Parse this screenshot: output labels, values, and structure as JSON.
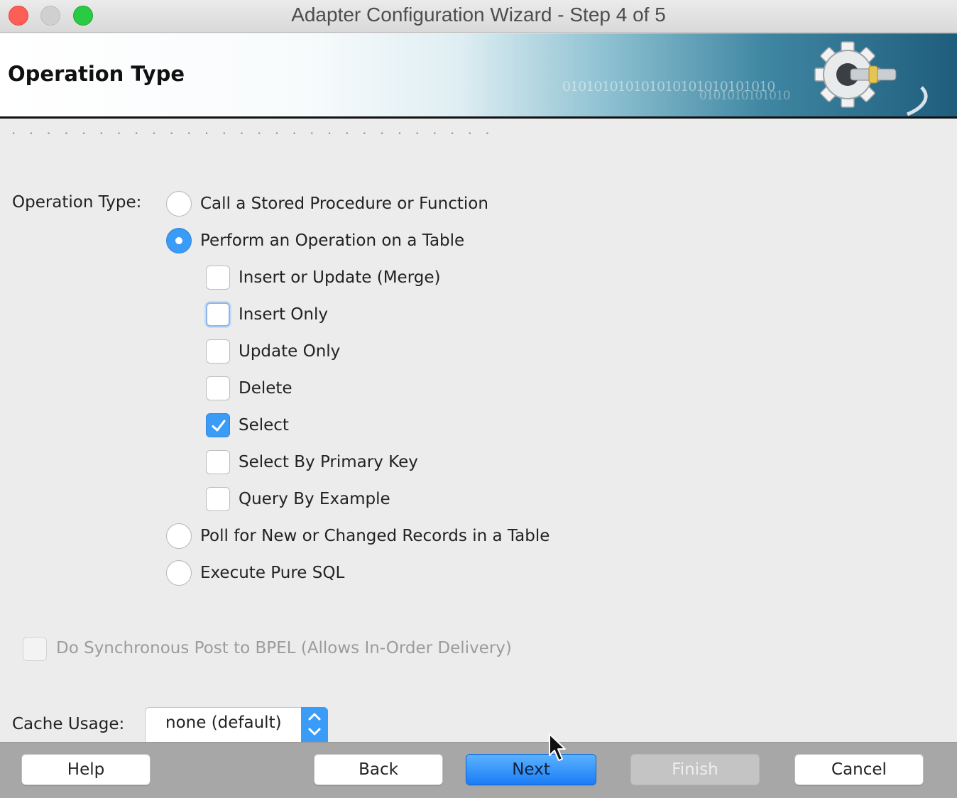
{
  "window": {
    "title": "Adapter Configuration Wizard - Step 4 of 5"
  },
  "banner": {
    "title": "Operation Type",
    "binary_1": "010101010101010101010101010",
    "binary_2": "0101010101010"
  },
  "form": {
    "operation_type_label": "Operation Type:",
    "radios": [
      {
        "label": "Call a Stored Procedure or Function",
        "selected": false
      },
      {
        "label": "Perform an Operation on a Table",
        "selected": true
      },
      {
        "label": "Poll for New or Changed Records in a Table",
        "selected": false
      },
      {
        "label": "Execute Pure SQL",
        "selected": false
      }
    ],
    "table_operations": [
      {
        "label": "Insert or Update (Merge)",
        "checked": false
      },
      {
        "label": "Insert Only",
        "checked": false
      },
      {
        "label": "Update Only",
        "checked": false
      },
      {
        "label": "Delete",
        "checked": false
      },
      {
        "label": "Select",
        "checked": true
      },
      {
        "label": "Select By Primary Key",
        "checked": false
      },
      {
        "label": "Query By Example",
        "checked": false
      }
    ],
    "sync_post_label": "Do Synchronous Post to BPEL (Allows In-Order Delivery)",
    "cache_usage_label": "Cache Usage:",
    "cache_usage_value": "none (default)"
  },
  "buttons": {
    "help": "Help",
    "back": "Back",
    "next": "Next",
    "finish": "Finish",
    "cancel": "Cancel"
  },
  "colors": {
    "accent": "#3b9cf8",
    "banner_dark": "#1f5d7d"
  }
}
